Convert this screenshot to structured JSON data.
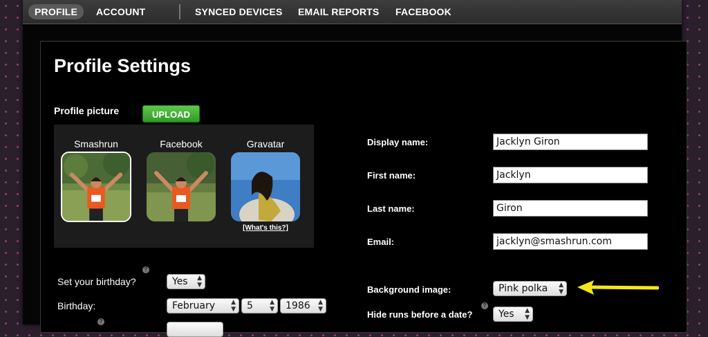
{
  "nav": {
    "items": [
      {
        "label": "PROFILE",
        "active": true
      },
      {
        "label": "ACCOUNT"
      },
      {
        "label": "SYNCED DEVICES"
      },
      {
        "label": "EMAIL REPORTS"
      },
      {
        "label": "FACEBOOK"
      }
    ]
  },
  "page_title": "Profile Settings",
  "profile_picture": {
    "label": "Profile picture",
    "upload_label": "UPLOAD",
    "sources": [
      {
        "label": "Smashrun",
        "selected": true
      },
      {
        "label": "Facebook"
      },
      {
        "label": "Gravatar"
      }
    ],
    "whats_this": "[What's this?]"
  },
  "form": {
    "display_name": {
      "label": "Display name:",
      "value": "Jacklyn Giron"
    },
    "first_name": {
      "label": "First name:",
      "value": "Jacklyn"
    },
    "last_name": {
      "label": "Last name:",
      "value": "Giron"
    },
    "email": {
      "label": "Email:",
      "value": "jacklyn@smashrun.com"
    },
    "background_image": {
      "label": "Background image:",
      "value": "Pink polka"
    },
    "hide_runs": {
      "label": "Hide runs before a date?",
      "value": "Yes"
    },
    "set_birthday": {
      "label": "Set your birthday?",
      "value": "Yes"
    },
    "birthday": {
      "label": "Birthday:",
      "month": "February",
      "day": "5",
      "year": "1986"
    }
  },
  "help_glyph": "?",
  "colors": {
    "accent_green": "#3aab2f",
    "highlight_arrow": "#f5e61b",
    "page_bg": "#050505"
  }
}
